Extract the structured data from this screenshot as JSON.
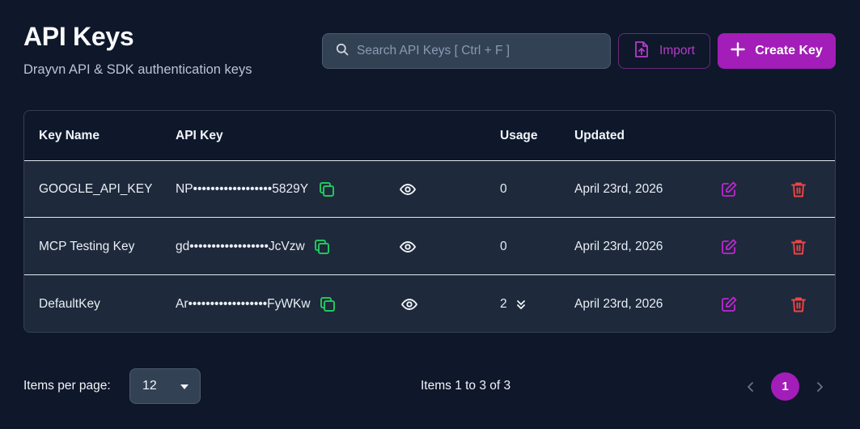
{
  "header": {
    "title": "API Keys",
    "subtitle": "Drayvn API & SDK authentication keys"
  },
  "search": {
    "placeholder": "Search API Keys [ Ctrl + F ]",
    "value": ""
  },
  "actions": {
    "import_label": "Import",
    "create_label": "Create Key"
  },
  "table": {
    "columns": [
      "Key Name",
      "API Key",
      "Usage",
      "Updated"
    ],
    "rows": [
      {
        "name": "GOOGLE_API_KEY",
        "key": "NP••••••••••••••••••5829Y",
        "usage": "0",
        "updated": "April 23rd, 2026",
        "expandable": false
      },
      {
        "name": "MCP Testing Key",
        "key": "gd••••••••••••••••••JcVzw",
        "usage": "0",
        "updated": "April 23rd, 2026",
        "expandable": false
      },
      {
        "name": "DefaultKey",
        "key": "Ar••••••••••••••••••FyWKw",
        "usage": "2",
        "updated": "April 23rd, 2026",
        "expandable": true
      }
    ]
  },
  "footer": {
    "items_per_page_label": "Items per page:",
    "items_per_page_value": "12",
    "range_text": "Items 1 to 3 of 3",
    "current_page": "1"
  },
  "icons": {
    "search": "search-icon",
    "import": "file-upload-icon",
    "create": "plus-icon",
    "copy": "copy-icon",
    "reveal": "eye-icon",
    "expand": "chevrons-down-icon",
    "edit": "edit-icon",
    "delete": "trash-icon",
    "prev": "chevron-left-icon",
    "next": "chevron-right-icon"
  },
  "colors": {
    "background": "#0f172a",
    "surface": "#1e293b",
    "accent": "#a31db8",
    "copy": "#22c55e",
    "edit": "#c026d3",
    "delete": "#ef4444"
  }
}
